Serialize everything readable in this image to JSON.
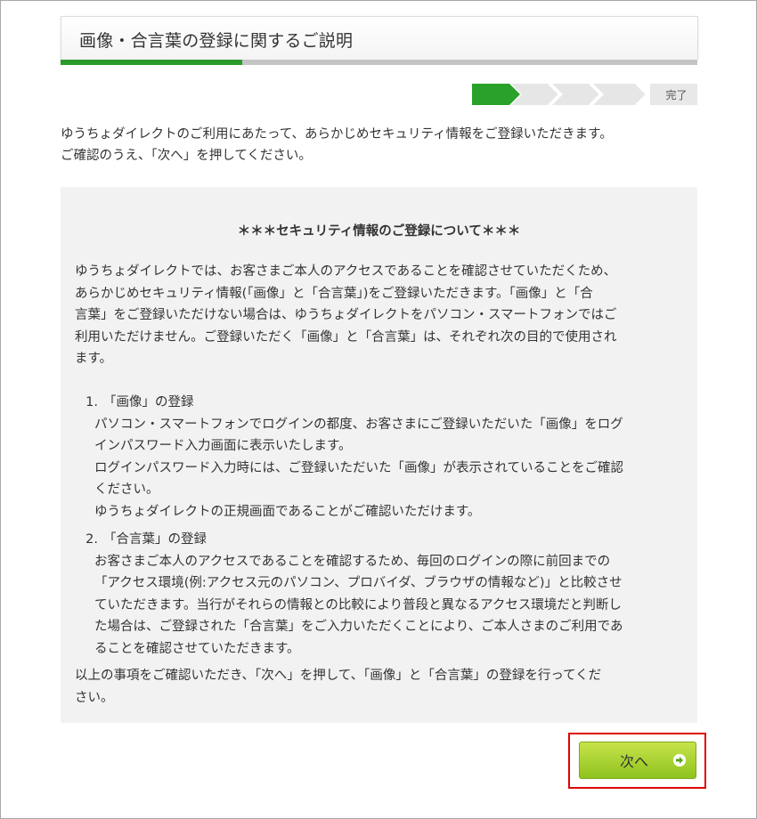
{
  "header": {
    "title": "画像・合言葉の登録に関するご説明",
    "progress_fraction": 0.285
  },
  "steps": {
    "total": 4,
    "current": 1,
    "done_label": "完了"
  },
  "intro": {
    "line1": "ゆうちょダイレクトのご利用にあたって、あらかじめセキュリティ情報をご登録いただきます。",
    "line2": "ご確認のうえ、「次へ」を押してください。"
  },
  "panel": {
    "heading": "＊＊＊セキュリティ情報のご登録について＊＊＊",
    "paragraph": [
      "ゆうちょダイレクトでは、お客さまご本人のアクセスであることを確認させていただくため、",
      "あらかじめセキュリティ情報(「画像」と「合言葉」)をご登録いただきます。「画像」と「合",
      "言葉」をご登録いただけない場合は、ゆうちょダイレクトをパソコン・スマートフォンではご",
      "利用いただけません。ご登録いただく「画像」と「合言葉」は、それぞれ次の目的で使用され",
      "ます。"
    ],
    "items": [
      {
        "number": "1.",
        "title": "「画像」の登録",
        "lines": [
          "パソコン・スマートフォンでログインの都度、お客さまにご登録いただいた「画像」をログ",
          "インパスワード入力画面に表示いたします。",
          "ログインパスワード入力時には、ご登録いただいた「画像」が表示されていることをご確認",
          "ください。",
          "ゆうちょダイレクトの正規画面であることがご確認いただけます。"
        ]
      },
      {
        "number": "2.",
        "title": "「合言葉」の登録",
        "lines": [
          "お客さまご本人のアクセスであることを確認するため、毎回のログインの際に前回までの",
          "「アクセス環境(例:アクセス元のパソコン、プロバイダ、ブラウザの情報など)」と比較させ",
          "ていただきます。当行がそれらの情報との比較により普段と異なるアクセス環境だと判断し",
          "た場合は、ご登録された「合言葉」をご入力いただくことにより、ご本人さまのご利用であ",
          "ることを確認させていただきます。"
        ]
      }
    ],
    "closing": [
      "以上の事項をご確認いただき、「次へ」を押して、「画像」と「合言葉」の登録を行ってくだ",
      "さい。"
    ]
  },
  "footer": {
    "next_label": "次へ"
  },
  "colors": {
    "progress_fill": "#2a9a2a",
    "step_active": "#2aa12a",
    "step_inactive": "#e6e6e6",
    "button_top": "#c7e34a",
    "button_bottom": "#8fc31f",
    "highlight": "#e00000",
    "arrow_icon": "#5aa61a"
  }
}
